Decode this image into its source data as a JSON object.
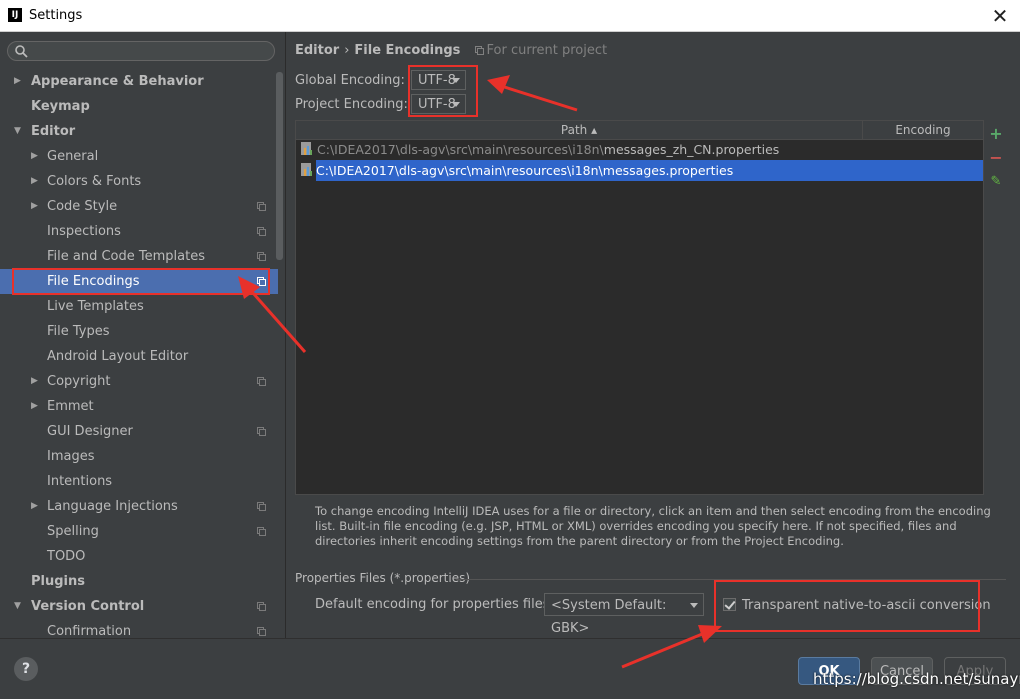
{
  "window": {
    "title": "Settings",
    "close_label": "✕"
  },
  "sidebar": {
    "search_placeholder": "",
    "items": [
      {
        "label": "Appearance & Behavior",
        "arrow": "▶"
      },
      {
        "label": "Keymap"
      },
      {
        "label": "Editor",
        "arrow": "▼"
      },
      {
        "label": "General",
        "arrow": "▶"
      },
      {
        "label": "Colors & Fonts",
        "arrow": "▶"
      },
      {
        "label": "Code Style",
        "arrow": "▶"
      },
      {
        "label": "Inspections"
      },
      {
        "label": "File and Code Templates"
      },
      {
        "label": "File Encodings"
      },
      {
        "label": "Live Templates"
      },
      {
        "label": "File Types"
      },
      {
        "label": "Android Layout Editor"
      },
      {
        "label": "Copyright",
        "arrow": "▶"
      },
      {
        "label": "Emmet",
        "arrow": "▶"
      },
      {
        "label": "GUI Designer"
      },
      {
        "label": "Images"
      },
      {
        "label": "Intentions"
      },
      {
        "label": "Language Injections",
        "arrow": "▶"
      },
      {
        "label": "Spelling"
      },
      {
        "label": "TODO"
      },
      {
        "label": "Plugins"
      },
      {
        "label": "Version Control",
        "arrow": "▼"
      },
      {
        "label": "Confirmation"
      }
    ]
  },
  "main": {
    "breadcrumb": {
      "parent": "Editor",
      "separator": "›",
      "current": "File Encodings",
      "scope": "For current project"
    },
    "global_encoding": {
      "label": "Global Encoding:",
      "value": "UTF-8"
    },
    "project_encoding": {
      "label": "Project Encoding:",
      "value": "UTF-8"
    },
    "table": {
      "columns": {
        "path": "Path ▴",
        "encoding": "Encoding"
      },
      "rows": [
        {
          "dir": "C:\\IDEA2017\\dls-agv\\src\\main\\resources\\i18n\\",
          "file": "messages_zh_CN.properties",
          "encoding": ""
        },
        {
          "dir": "C:\\IDEA2017\\dls-agv\\src\\main\\resources\\i18n\\",
          "file": "messages.properties",
          "encoding": ""
        }
      ],
      "tools": {
        "add": "+",
        "remove": "−",
        "edit": "✎"
      }
    },
    "info_text": "To change encoding IntelliJ IDEA uses for a file or directory, click an item and then select encoding from the encoding list. Built-in file encoding (e.g. JSP, HTML or XML) overrides encoding you specify here. If not specified, files and directories inherit encoding settings from the parent directory or from the Project Encoding.",
    "properties_files": {
      "title": "Properties Files (*.properties)",
      "default_label": "Default encoding for properties files:",
      "default_value": "<System Default: GBK>",
      "transparent_label": "Transparent native-to-ascii conversion",
      "transparent_checked": true
    }
  },
  "footer": {
    "help": "?",
    "ok": "OK",
    "cancel": "Cancel",
    "apply": "Apply"
  },
  "watermark": "https://blog.csdn.net/sunayn",
  "colors": {
    "accent": "#4b6eaf",
    "selected_row": "#2f65ca",
    "annotation": "#e8312a"
  }
}
